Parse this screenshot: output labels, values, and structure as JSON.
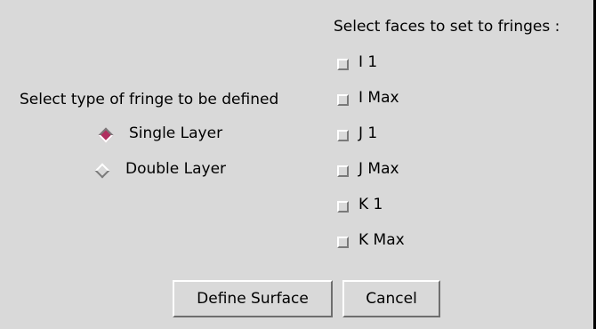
{
  "faces_section": {
    "title": "Select faces to set to fringes :",
    "faces": [
      {
        "label": "I 1"
      },
      {
        "label": "I Max"
      },
      {
        "label": "J 1"
      },
      {
        "label": "J Max"
      },
      {
        "label": "K 1"
      },
      {
        "label": "K Max"
      }
    ]
  },
  "fringe_type": {
    "title": "Select type of fringe to be defined",
    "options": [
      {
        "label": "Single Layer",
        "selected": true
      },
      {
        "label": "Double Layer",
        "selected": false
      }
    ]
  },
  "buttons": {
    "define_surface": "Define Surface",
    "cancel": "Cancel"
  },
  "colors": {
    "background": "#d9d9d9",
    "radio_selected": "#b03060"
  }
}
